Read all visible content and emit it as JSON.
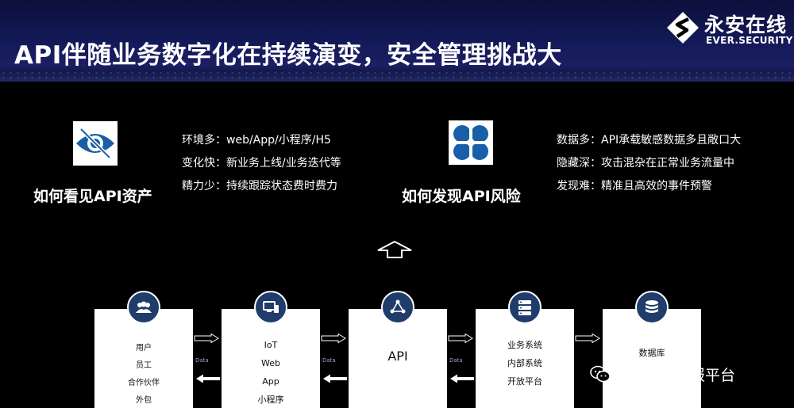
{
  "slide": {
    "title": "API伴随业务数字化在持续演变，安全管理挑战大"
  },
  "logo": {
    "name_cn": "永安在线",
    "name_en": "EVER.SECURITY",
    "icon": "ever-security-logo-icon"
  },
  "asset_block": {
    "icon": "hidden-eye-icon",
    "heading": "如何看见API资产",
    "bullets": [
      "环境多：web/App/小程序/H5",
      "变化快：新业务上线/业务迭代等",
      "精力少：持续跟踪状态费时费力"
    ]
  },
  "risk_block": {
    "icon": "clover-grid-icon",
    "heading": "如何发现API风险",
    "bullets": [
      "数据多：API承载敏感数据多且敞口大",
      "隐藏深：攻击混杂在正常业务流量中",
      "发现难：精准且高效的事件预警"
    ]
  },
  "flow": {
    "data_label": "Data",
    "nodes": [
      {
        "icon": "users-icon",
        "lines": [
          "用户",
          "员工",
          "合作伙伴",
          "外包"
        ]
      },
      {
        "icon": "devices-icon",
        "lines": [
          "IoT",
          "Web",
          "App",
          "小程序"
        ]
      },
      {
        "icon": "api-network-icon",
        "lines": [
          "API"
        ]
      },
      {
        "icon": "server-stack-icon",
        "lines": [
          "业务系统",
          "内部系统",
          "开放平台"
        ]
      },
      {
        "icon": "database-icon",
        "lines": [
          "数据库"
        ]
      }
    ]
  },
  "watermark": {
    "icon": "wechat-icon",
    "text": "永安在线情报平台"
  },
  "colors": {
    "background": "#000000",
    "header_band": "#141a5a",
    "icon_blue": "#1a5ea8",
    "node_circle": "#1f3c6b",
    "card": "#ffffff"
  }
}
